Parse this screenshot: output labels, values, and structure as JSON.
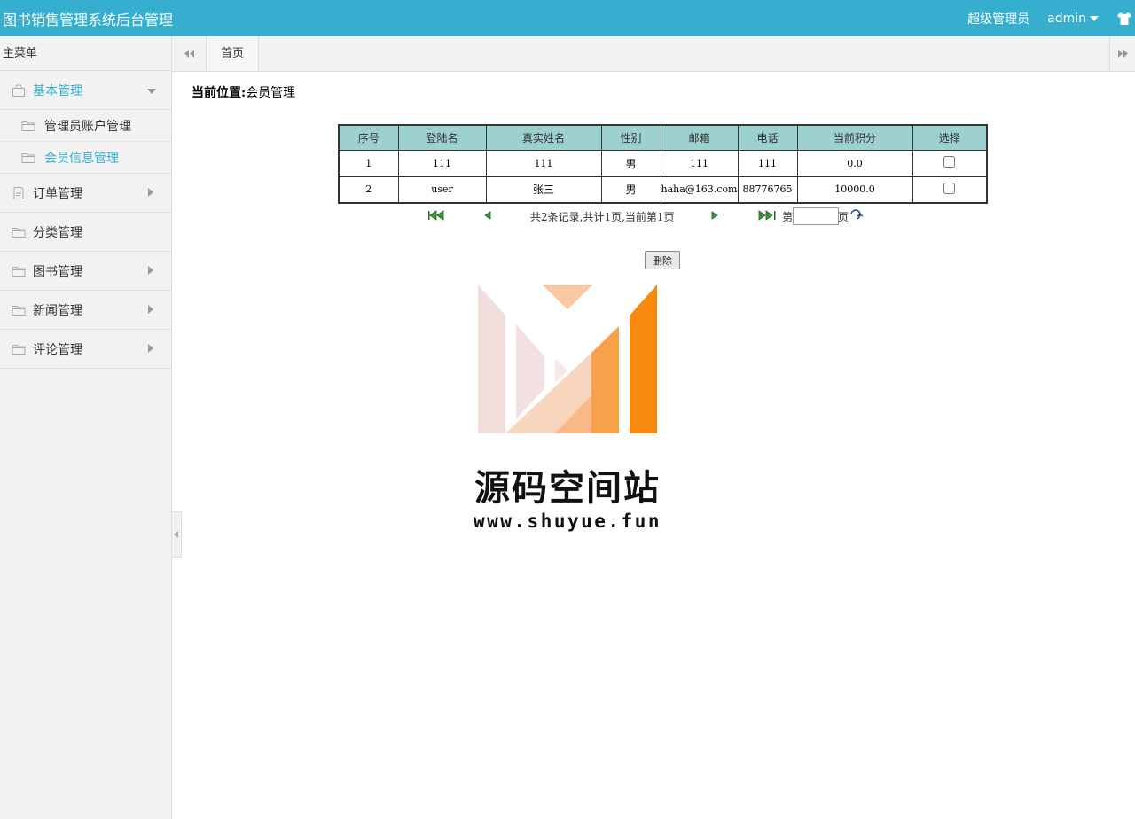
{
  "header": {
    "title": "图书销售管理系统后台管理",
    "role": "超级管理员",
    "user": "admin",
    "brand_color": "#35aecf"
  },
  "sidebar": {
    "header": "主菜单",
    "groups": [
      {
        "label": "基本管理",
        "icon": "bag-icon",
        "expanded": true,
        "active": true,
        "children": [
          {
            "label": "管理员账户管理",
            "icon": "folder-icon"
          },
          {
            "label": "会员信息管理",
            "icon": "folder-icon",
            "active": true
          }
        ]
      },
      {
        "label": "订单管理",
        "icon": "document-icon"
      },
      {
        "label": "分类管理",
        "icon": "folder-icon"
      },
      {
        "label": "图书管理",
        "icon": "folder-icon"
      },
      {
        "label": "新闻管理",
        "icon": "folder-icon"
      },
      {
        "label": "评论管理",
        "icon": "folder-icon"
      }
    ]
  },
  "tabs": {
    "home": "首页"
  },
  "breadcrumb": {
    "prefix": "当前位置:",
    "current": "会员管理"
  },
  "table": {
    "headers": [
      "序号",
      "登陆名",
      "真实姓名",
      "性别",
      "邮箱",
      "电话",
      "当前积分",
      "选择"
    ],
    "rows": [
      [
        "1",
        "111",
        "111",
        "男",
        "111",
        "111",
        "0.0"
      ],
      [
        "2",
        "user",
        "张三",
        "男",
        "haha@163.com",
        "88776765",
        "10000.0"
      ]
    ]
  },
  "pager": {
    "info": "共2条记录,共计1页,当前第1页",
    "page_label_prefix": "第",
    "page_label_suffix": "页",
    "page_input_value": ""
  },
  "actions": {
    "delete": "删除"
  },
  "watermark": {
    "text": "源码空间站",
    "url": "www.shuyue.fun"
  }
}
